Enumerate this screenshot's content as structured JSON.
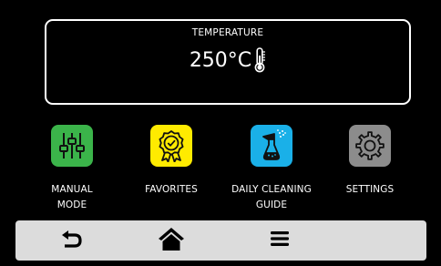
{
  "temperature": {
    "label": "TEMPERATURE",
    "value": "250°C"
  },
  "tiles": [
    {
      "label": "MANUAL\nMODE",
      "icon": "sliders-icon",
      "color": "#3bb44a"
    },
    {
      "label": "FAVORITES",
      "icon": "award-ribbon-icon",
      "color": "#ffeb00"
    },
    {
      "label": "DAILY CLEANING\nGUIDE",
      "icon": "spray-bottle-icon",
      "color": "#1ab0e8"
    },
    {
      "label": "SETTINGS",
      "icon": "gear-icon",
      "color": "#8c8c8c"
    }
  ],
  "bottom_nav": {
    "buttons": [
      "back-icon",
      "home-icon",
      "menu-icon"
    ]
  }
}
